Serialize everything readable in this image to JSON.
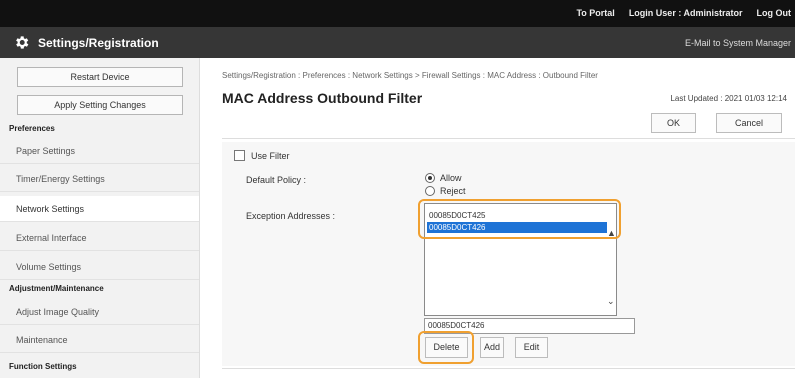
{
  "topbar": {
    "to_portal": "To Portal",
    "login_user": "Login User :  Administrator",
    "logout": "Log Out"
  },
  "header": {
    "title": "Settings/Registration",
    "mail_link": "E-Mail to System Manager"
  },
  "sidebar": {
    "restart_button": "Restart Device",
    "apply_button": "Apply Setting Changes",
    "sections": [
      {
        "heading": "Preferences",
        "items": [
          "Paper Settings",
          "Timer/Energy Settings",
          "Network Settings",
          "External Interface",
          "Volume Settings"
        ]
      },
      {
        "heading": "Adjustment/Maintenance",
        "items": [
          "Adjust Image Quality",
          "Maintenance"
        ]
      },
      {
        "heading": "Function Settings",
        "items": []
      }
    ],
    "active_item": "Network Settings"
  },
  "main": {
    "breadcrumb": "Settings/Registration : Preferences : Network Settings > Firewall Settings : MAC Address : Outbound Filter",
    "title": "MAC Address Outbound Filter",
    "last_updated": "Last Updated : 2021 01/03 12:14",
    "ok_button": "OK",
    "cancel_button": "Cancel",
    "use_filter_label": "Use Filter",
    "use_filter_checked": false,
    "default_policy_label": "Default Policy :",
    "policy_options": [
      "Allow",
      "Reject"
    ],
    "policy_selected": "Allow",
    "exception_label": "Exception Addresses :",
    "exception_addresses": [
      "00085D0CT425",
      "00085D0CT426"
    ],
    "selected_address": "00085D0CT426",
    "address_input_value": "00085D0CT426",
    "delete_button": "Delete",
    "add_button": "Add",
    "edit_button": "Edit"
  },
  "colors": {
    "highlight": "#f0a030",
    "selection": "#1e73d6",
    "header_bg": "#363636",
    "topbar_bg": "#111111"
  }
}
